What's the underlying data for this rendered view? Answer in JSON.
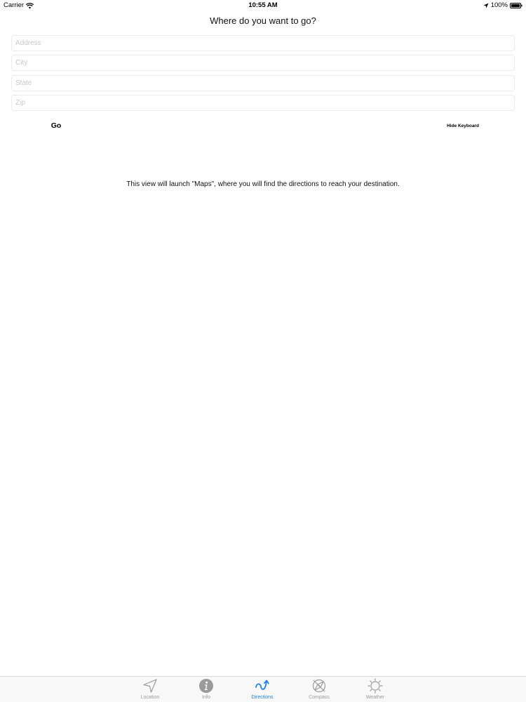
{
  "status_bar": {
    "carrier": "Carrier",
    "time": "10:55 AM",
    "battery": "100%",
    "icons": [
      "wifi-icon",
      "location-arrow-icon",
      "battery-icon"
    ]
  },
  "header": {
    "title": "Where do you want to go?"
  },
  "form": {
    "address_placeholder": "Address",
    "city_placeholder": "City",
    "state_placeholder": "State",
    "zip_placeholder": "Zip",
    "go_label": "Go",
    "hide_keyboard_label": "Hide Keyboard"
  },
  "main": {
    "info_text": "This view will launch \"Maps\", where you will find the directions to reach your destination."
  },
  "tab_bar": {
    "accent_color": "#1a82e2",
    "inactive_color": "#9a9a9a",
    "items": [
      {
        "label": "Location",
        "icon": "location-arrow-icon",
        "active": false
      },
      {
        "label": "Info",
        "icon": "info-icon",
        "active": false
      },
      {
        "label": "Directions",
        "icon": "directions-icon",
        "active": true
      },
      {
        "label": "Compass",
        "icon": "compass-icon",
        "active": false
      },
      {
        "label": "Weather",
        "icon": "sun-icon",
        "active": false
      }
    ]
  }
}
